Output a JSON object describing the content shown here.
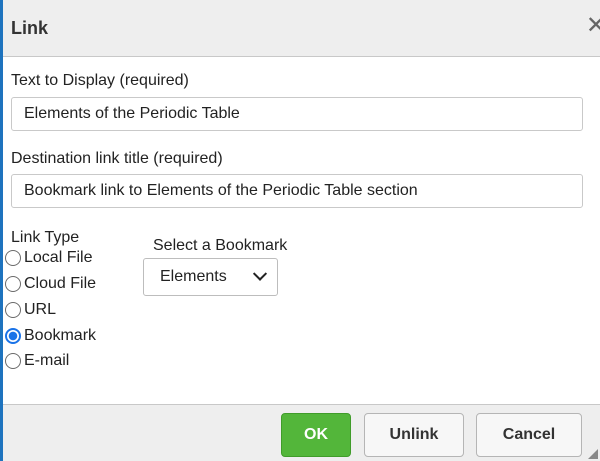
{
  "dialog": {
    "title": "Link",
    "close_glyph": "✕",
    "close_icon": "close-icon"
  },
  "text_display": {
    "label": "Text to Display (required)",
    "value": "Elements of the Periodic Table"
  },
  "dest_title": {
    "label": "Destination link title (required)",
    "value": "Bookmark link to Elements of the Periodic Table section"
  },
  "link_type": {
    "label": "Link Type",
    "options": [
      {
        "label": "Local File",
        "checked": false
      },
      {
        "label": "Cloud File",
        "checked": false
      },
      {
        "label": "URL",
        "checked": false
      },
      {
        "label": "Bookmark",
        "checked": true
      },
      {
        "label": "E-mail",
        "checked": false
      }
    ]
  },
  "bookmark": {
    "label": "Select a Bookmark",
    "selected": "Elements"
  },
  "buttons": {
    "ok": "OK",
    "unlink": "Unlink",
    "cancel": "Cancel"
  },
  "colors": {
    "accent_border": "#1e73be",
    "ok_button": "#53b63a",
    "radio_checked": "#1a73e8",
    "bar_bg": "#eeeeee"
  }
}
